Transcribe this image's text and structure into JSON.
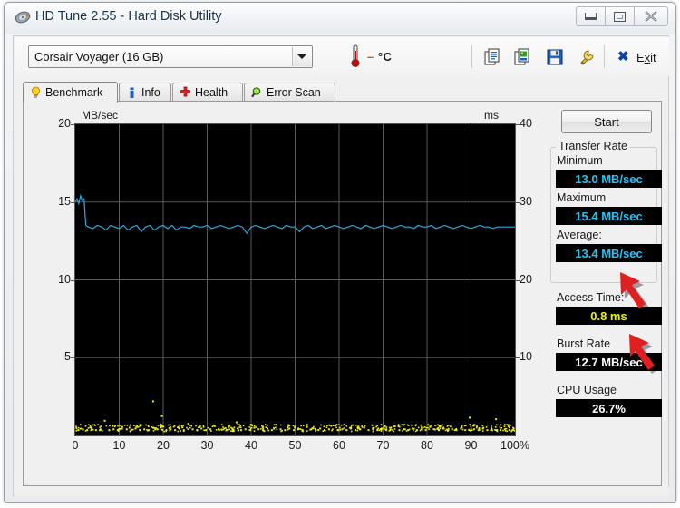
{
  "window": {
    "title": "HD Tune 2.55 - Hard Disk Utility",
    "app_icon": "hard-disk-icon",
    "controls": {
      "minimize": "–",
      "maximize": "□",
      "close": "✕"
    }
  },
  "toolbar": {
    "drive_selected": "Corsair Voyager (16 GB)",
    "drive_options": [
      "Corsair Voyager (16 GB)"
    ],
    "temperature": "– °C",
    "temperature_dash": "–",
    "temperature_unit": "°C",
    "icons": [
      "copy-icon",
      "copy-image-icon",
      "save-icon",
      "tools-icon"
    ],
    "exit_label": "Exit",
    "exit_mnemonic": "x"
  },
  "tabs": [
    {
      "label": "Benchmark",
      "icon": "lightbulb-icon",
      "active": true
    },
    {
      "label": "Info",
      "icon": "info-icon",
      "active": false
    },
    {
      "label": "Health",
      "icon": "health-cross-icon",
      "active": false
    },
    {
      "label": "Error Scan",
      "icon": "magnifier-icon",
      "active": false
    }
  ],
  "results": {
    "start_button": "Start",
    "transfer_rate_group": "Transfer Rate",
    "minimum_label": "Minimum",
    "minimum_value": "13.0 MB/sec",
    "maximum_label": "Maximum",
    "maximum_value": "15.4 MB/sec",
    "average_label": "Average:",
    "average_value": "13.4 MB/sec",
    "access_time_label": "Access Time:",
    "access_time_value": "0.8 ms",
    "burst_rate_label": "Burst Rate",
    "burst_rate_value": "12.7 MB/sec",
    "cpu_usage_label": "CPU Usage",
    "cpu_usage_value": "26.7%"
  },
  "colors": {
    "transfer_line": "#29a8e0",
    "access_dots": "#f2f207",
    "value_cyan": "#20c5f5",
    "value_yellow": "#f2f207",
    "plot_background": "#000000",
    "grid": "#5a5a5a",
    "arrow_red": "#e02020"
  },
  "annotations": [
    {
      "name": "arrow-average",
      "points_to": "average_value"
    },
    {
      "name": "arrow-access-time",
      "points_to": "access_time_value"
    }
  ],
  "chart_data": {
    "type": "line",
    "title": "",
    "xlabel": "100%",
    "ylabel": "MB/sec",
    "y2label": "ms",
    "xlim": [
      0,
      100
    ],
    "ylim": [
      0,
      20
    ],
    "y2lim": [
      0,
      40
    ],
    "grid": true,
    "x_ticks": [
      0,
      10,
      20,
      30,
      40,
      50,
      60,
      70,
      80,
      90,
      100
    ],
    "x_tick_labels": [
      "0",
      "10",
      "20",
      "30",
      "40",
      "50",
      "60",
      "70",
      "80",
      "90",
      "100%"
    ],
    "y_ticks": [
      5,
      10,
      15,
      20
    ],
    "y_tick_labels": [
      "5",
      "10",
      "15",
      "20"
    ],
    "y2_ticks": [
      10,
      20,
      30,
      40
    ],
    "y2_tick_labels": [
      "10",
      "20",
      "30",
      "40"
    ],
    "series": [
      {
        "name": "Transfer rate",
        "axis": "left",
        "unit": "MB/sec",
        "color": "#29a8e0",
        "x": [
          0,
          0.4,
          0.8,
          1.2,
          1.6,
          2,
          2.4,
          3,
          4,
          5,
          6,
          7,
          8,
          9,
          10,
          11,
          12,
          13,
          14,
          15,
          16,
          17,
          18,
          19,
          20,
          21,
          22,
          23,
          24,
          25,
          26,
          27,
          28,
          29,
          30,
          31,
          32,
          33,
          34,
          35,
          36,
          37,
          38,
          39,
          40,
          41,
          42,
          43,
          44,
          45,
          46,
          47,
          48,
          49,
          50,
          51,
          52,
          53,
          54,
          55,
          56,
          57,
          58,
          59,
          60,
          61,
          62,
          63,
          64,
          65,
          66,
          67,
          68,
          69,
          70,
          71,
          72,
          73,
          74,
          75,
          76,
          77,
          78,
          79,
          80,
          81,
          82,
          83,
          84,
          85,
          86,
          87,
          88,
          89,
          90,
          91,
          92,
          93,
          94,
          95,
          96,
          97,
          98,
          99,
          100
        ],
        "y": [
          15.0,
          15.2,
          14.9,
          15.4,
          15.1,
          15.2,
          13.5,
          13.4,
          13.3,
          13.5,
          13.4,
          13.2,
          13.5,
          13.4,
          13.3,
          13.5,
          13.2,
          13.4,
          13.5,
          13.1,
          13.4,
          13.5,
          13.2,
          13.4,
          13.5,
          13.3,
          13.5,
          13.2,
          13.4,
          13.4,
          13.3,
          13.5,
          13.4,
          13.4,
          13.5,
          13.3,
          13.4,
          13.5,
          13.4,
          13.3,
          13.4,
          13.5,
          13.4,
          13.0,
          13.4,
          13.5,
          13.4,
          13.3,
          13.4,
          13.5,
          13.4,
          13.3,
          13.5,
          13.4,
          13.4,
          13.1,
          13.4,
          13.5,
          13.3,
          13.4,
          13.5,
          13.3,
          13.4,
          13.5,
          13.4,
          13.3,
          13.4,
          13.5,
          13.4,
          13.3,
          13.5,
          13.4,
          13.3,
          13.4,
          13.5,
          13.4,
          13.3,
          13.4,
          13.5,
          13.4,
          13.4,
          13.3,
          13.5,
          13.4,
          13.4,
          13.5,
          13.3,
          13.4,
          13.5,
          13.4,
          13.3,
          13.4,
          13.5,
          13.4,
          13.3,
          13.4,
          13.5,
          13.4,
          13.4,
          13.3,
          13.4,
          13.4,
          13.4,
          13.4,
          13.4,
          13.4
        ]
      },
      {
        "name": "Access time",
        "axis": "right",
        "unit": "ms",
        "color": "#f2f207",
        "style": "scatter",
        "x": [
          0.5,
          1.5,
          2.5,
          3.5,
          4.5,
          5.5,
          6.5,
          7.5,
          8.5,
          9.5,
          10.5,
          11.5,
          12.5,
          13.5,
          14.5,
          15.5,
          16.5,
          17.5,
          18.5,
          19.5,
          20.5,
          21.5,
          22.5,
          23.5,
          24.5,
          25.5,
          26.5,
          27.5,
          28.5,
          29.5,
          30.5,
          31.5,
          32.5,
          33.5,
          34.5,
          35.5,
          36.5,
          37.5,
          38.5,
          39.5,
          40.5,
          41.5,
          42.5,
          43.5,
          44.5,
          45.5,
          46.5,
          47.5,
          48.5,
          49.5,
          50.5,
          51.5,
          52.5,
          53.5,
          54.5,
          55.5,
          56.5,
          57.5,
          58.5,
          59.5,
          60.5,
          61.5,
          62.5,
          63.5,
          64.5,
          65.5,
          66.5,
          67.5,
          68.5,
          69.5,
          70.5,
          71.5,
          72.5,
          73.5,
          74.5,
          75.5,
          76.5,
          77.5,
          78.5,
          79.5,
          80.5,
          81.5,
          82.5,
          83.5,
          84.5,
          85.5,
          86.5,
          87.5,
          88.5,
          89.5,
          90.5,
          91.5,
          92.5,
          93.5,
          94.5,
          95.5,
          96.5,
          97.5,
          98.5,
          99.5
        ],
        "y": [
          0.8,
          0.9,
          0.8,
          1.0,
          0.8,
          0.9,
          2.0,
          0.8,
          0.9,
          0.8,
          1.2,
          0.9,
          0.8,
          1.0,
          0.8,
          0.9,
          0.8,
          4.5,
          0.9,
          2.6,
          0.8,
          0.9,
          0.8,
          1.0,
          0.8,
          1.6,
          0.9,
          0.8,
          1.0,
          0.8,
          0.9,
          1.3,
          0.8,
          0.9,
          0.8,
          1.0,
          1.8,
          0.8,
          0.9,
          0.8,
          1.1,
          0.9,
          0.8,
          1.0,
          0.8,
          1.5,
          0.9,
          0.8,
          1.0,
          0.8,
          0.9,
          0.8,
          1.2,
          0.9,
          0.8,
          1.0,
          0.8,
          0.9,
          1.4,
          0.8,
          0.9,
          0.8,
          1.0,
          0.8,
          0.9,
          1.1,
          0.8,
          0.9,
          0.8,
          1.0,
          0.8,
          0.9,
          1.3,
          0.8,
          0.9,
          0.8,
          1.0,
          0.8,
          0.9,
          0.8,
          1.2,
          0.9,
          0.8,
          1.0,
          0.8,
          0.9,
          0.8,
          1.0,
          0.8,
          2.4,
          0.9,
          0.8,
          1.0,
          0.8,
          0.9,
          2.2,
          0.8,
          0.9,
          0.8,
          1.0
        ]
      }
    ]
  }
}
